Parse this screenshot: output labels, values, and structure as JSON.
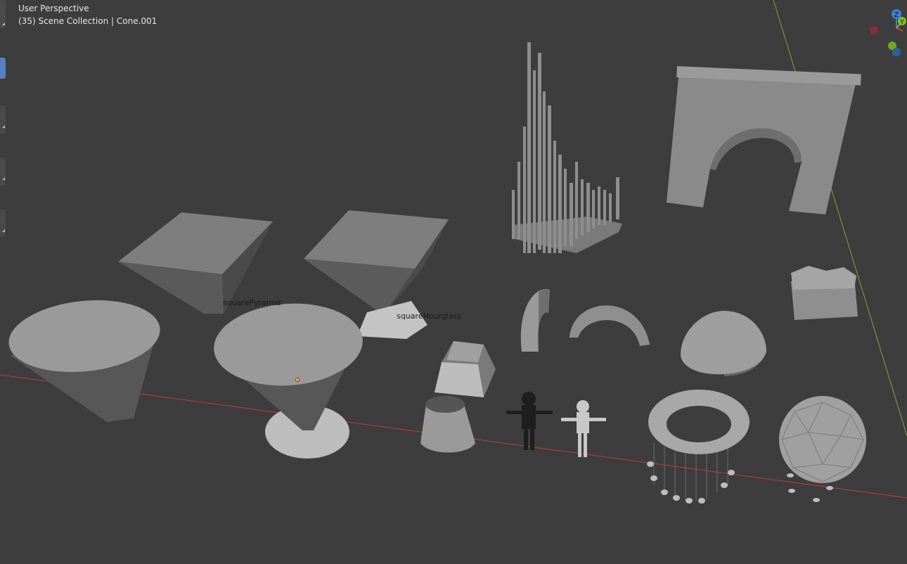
{
  "viewport": {
    "view_mode": "User Perspective",
    "collection_info": "(35) Scene Collection | Cone.001"
  },
  "object_labels": {
    "square_pyramid": "squarePyramid",
    "square_hourglass": "squareHourglass"
  },
  "gizmo": {
    "z_label": "Z",
    "y_label": "Y",
    "colors": {
      "x": "#d13a4c",
      "y": "#7bc21f",
      "z": "#3d7fd6"
    }
  },
  "colors": {
    "background": "#3d3d3d",
    "x_axis": "#c43a3a",
    "y_axis": "#8aa033",
    "selection": "#f0a030"
  }
}
